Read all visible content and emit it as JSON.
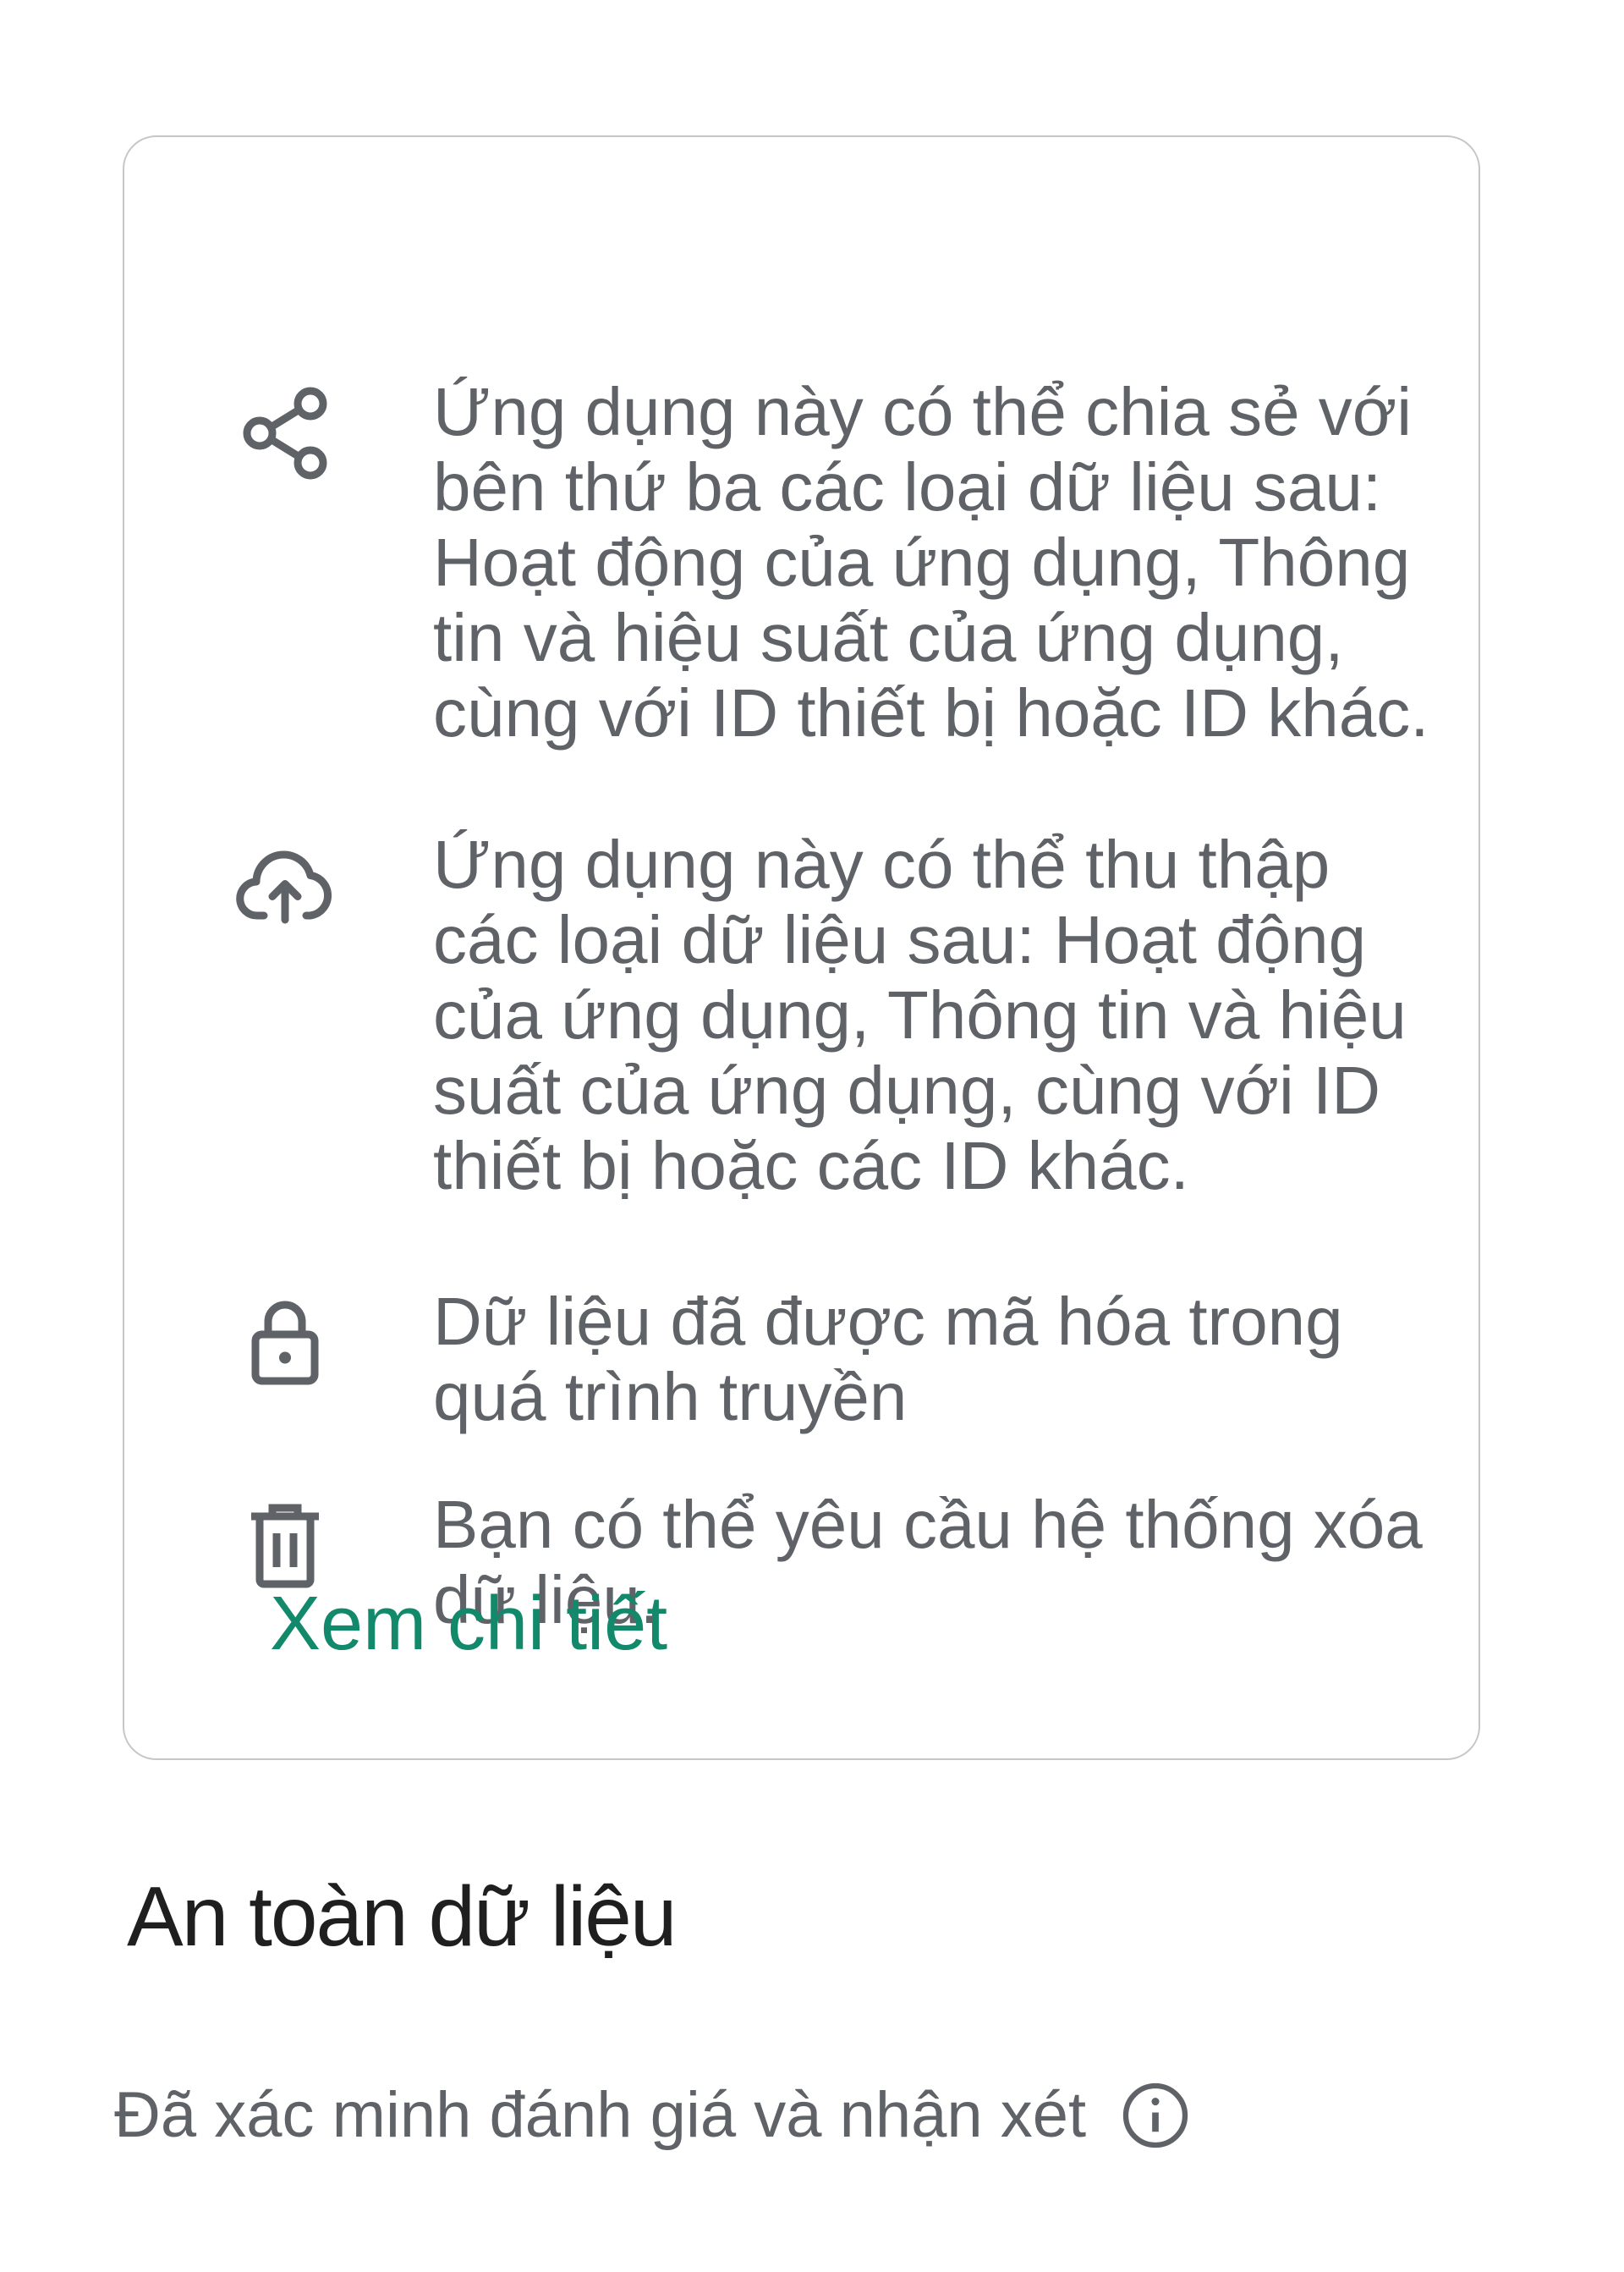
{
  "card": {
    "items": [
      {
        "icon": "share-icon",
        "text": "Ứng dụng này có thể chia sẻ với bên thứ ba các loại dữ liệu sau: Hoạt động của ứng dụng, Thông tin và hiệu suất của ứng dụng, cùng với ID thiết bị hoặc ID khác."
      },
      {
        "icon": "cloud-upload-icon",
        "text": "Ứng dụng này có thể thu thập các loại dữ liệu sau: Hoạt động của ứng dụng, Thông tin và hiệu suất của ứng dụng, cùng với ID thiết bị hoặc các ID khác."
      },
      {
        "icon": "lock-icon",
        "text": "Dữ liệu đã được mã hóa trong quá trình truyền"
      },
      {
        "icon": "trash-icon",
        "text": "Bạn có thể yêu cầu hệ thống xóa dữ liệu."
      }
    ],
    "details_link": "Xem chi tiết"
  },
  "section": {
    "title": "An toàn dữ liệu",
    "subtitle": "Đã xác minh đánh giá và nhận xét",
    "subtitle_icon": "info-icon"
  },
  "colors": {
    "text_secondary": "#5f6368",
    "accent_green": "#11896a",
    "title": "#1f1f1f",
    "card_border": "#c4c7c5"
  }
}
